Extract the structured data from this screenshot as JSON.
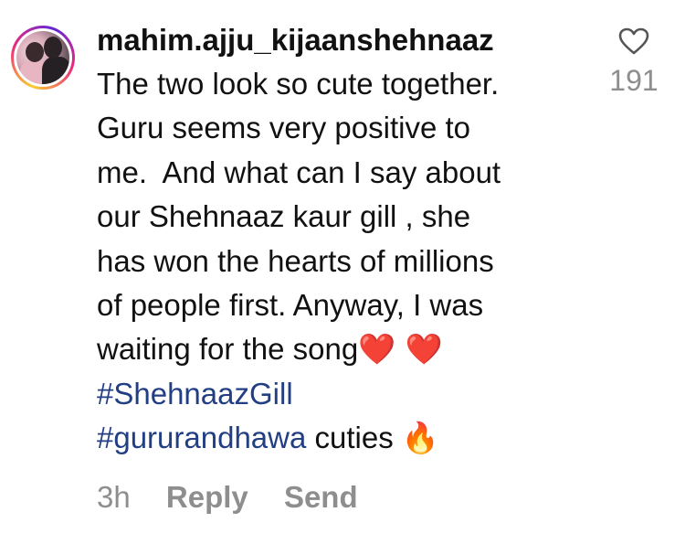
{
  "comment": {
    "username": "mahim.ajju_kijaanshehnaaz",
    "lines": [
      "The two look so cute together.",
      "Guru seems very positive to",
      "me.  And what can I say about",
      "our Shehnaaz kaur gill , she",
      "has won the hearts of millions",
      "of people first. Anyway, I was",
      "waiting for the song"
    ],
    "hearts": "❤️ ❤️",
    "hashtag1": "#ShehnaazGill",
    "hashtag2": "#gururandhawa",
    "trailing_text": " cuties ",
    "fire": "🔥",
    "time": "3h",
    "reply_label": "Reply",
    "send_label": "Send",
    "like_count": "191"
  },
  "icons": {
    "like": "heart-outline-icon",
    "heart_color": "#e0222f",
    "hashtag_color": "#223f83",
    "meta_color": "#8e8e8e"
  }
}
